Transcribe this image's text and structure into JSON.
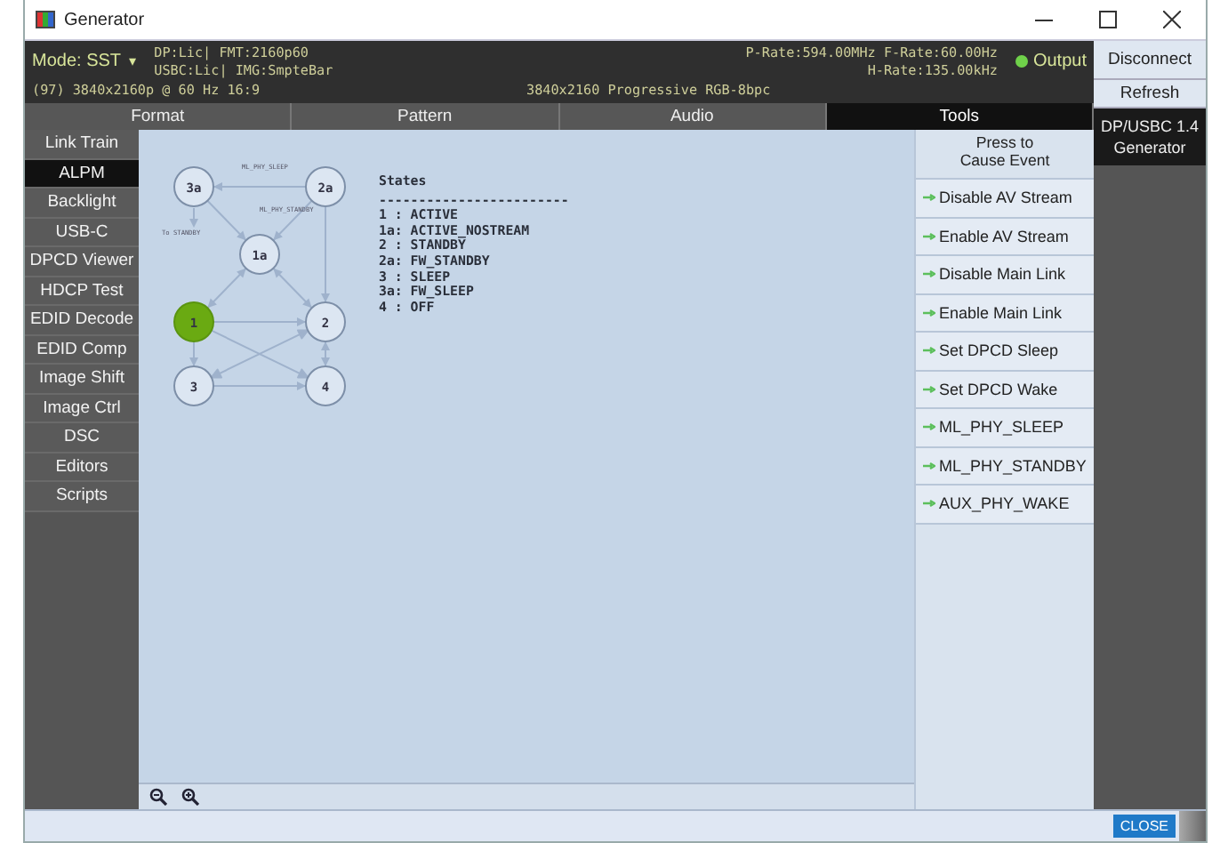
{
  "window": {
    "title": "Generator"
  },
  "header": {
    "mode": "Mode: SST",
    "mode_caret": "▾",
    "line_1_left": "DP:Lic| FMT:2160p60",
    "line_2_left": "USBC:Lic| IMG:SmpteBar",
    "line_1_right": "P-Rate:594.00MHz F-Rate:60.00Hz",
    "line_2_right": "H-Rate:135.00kHz",
    "output": {
      "label": "Output",
      "on": true
    },
    "line_3_left": "(97) 3840x2160p @ 60 Hz 16:9",
    "line_3_center": "3840x2160  Progressive  RGB-8bpc"
  },
  "side_buttons": [
    "Disconnect",
    "Refresh"
  ],
  "device_label": "DP/USBC 1.4 Generator",
  "tabs": [
    {
      "label": "Format",
      "selected": false
    },
    {
      "label": "Pattern",
      "selected": false
    },
    {
      "label": "Audio",
      "selected": false
    },
    {
      "label": "Tools",
      "selected": true
    }
  ],
  "sidebar": {
    "items": [
      {
        "label": "Link Train",
        "selected": false
      },
      {
        "label": "ALPM",
        "selected": true
      },
      {
        "label": "Backlight",
        "selected": false
      },
      {
        "label": "USB-C",
        "selected": false
      },
      {
        "label": "DPCD Viewer",
        "selected": false
      },
      {
        "label": "HDCP Test",
        "selected": false
      },
      {
        "label": "EDID Decode",
        "selected": false
      },
      {
        "label": "EDID Comp",
        "selected": false
      },
      {
        "label": "Image Shift",
        "selected": false
      },
      {
        "label": "Image Ctrl",
        "selected": false
      },
      {
        "label": "DSC",
        "selected": false
      },
      {
        "label": "Editors",
        "selected": false
      },
      {
        "label": "Scripts",
        "selected": false
      }
    ]
  },
  "diagram": {
    "nodes": [
      {
        "label": "3a",
        "active": false
      },
      {
        "label": "2a",
        "active": false
      },
      {
        "label": "1a",
        "active": false
      },
      {
        "label": "1",
        "active": true
      },
      {
        "label": "2",
        "active": false
      },
      {
        "label": "3",
        "active": false
      },
      {
        "label": "4",
        "active": false
      }
    ],
    "edge_labels": [
      "ML_PHY_SLEEP",
      "ML_PHY_STANDBY",
      "To STANDBY"
    ]
  },
  "states": {
    "title": "States",
    "rule": "------------------------",
    "lines": [
      "1 : ACTIVE",
      "1a: ACTIVE_NOSTREAM",
      "2 : STANDBY",
      "2a: FW_STANDBY",
      "3 : SLEEP",
      "3a: FW_SLEEP",
      "4 : OFF"
    ]
  },
  "events": {
    "title": "Press to\nCause Event",
    "buttons": [
      "Disable AV Stream",
      "Enable AV Stream",
      "Disable Main Link",
      "Enable Main Link",
      "Set DPCD Sleep",
      "Set DPCD Wake",
      "ML_PHY_SLEEP",
      "ML_PHY_STANDBY",
      "AUX_PHY_WAKE"
    ]
  },
  "footer": {
    "close": "CLOSE"
  }
}
